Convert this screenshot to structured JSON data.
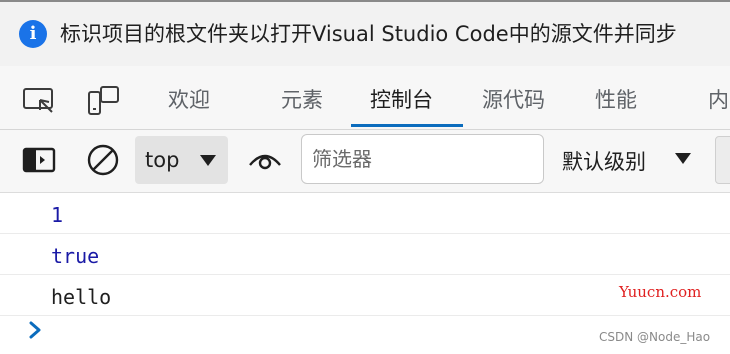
{
  "infobar": {
    "icon": "info-icon",
    "icon_glyph": "i",
    "message": "标识项目的根文件夹以打开Visual Studio Code中的源文件并同步"
  },
  "tabs": [
    {
      "label": "欢迎"
    },
    {
      "label": "元素"
    },
    {
      "label": "控制台",
      "active": true
    },
    {
      "label": "源代码"
    },
    {
      "label": "性能"
    },
    {
      "label": "内"
    }
  ],
  "toolbar": {
    "context_value": "top",
    "filter_placeholder": "筛选器",
    "levels_label": "默认级别"
  },
  "console": {
    "lines": [
      {
        "text": "1",
        "kind": "number"
      },
      {
        "text": "true",
        "kind": "boolean"
      },
      {
        "text": "hello",
        "kind": "string"
      }
    ]
  },
  "watermark": "Yuucn.com",
  "credit": "CSDN @Node_Hao",
  "colors": {
    "accent": "#0b6cbd",
    "info_icon": "#1a73e8",
    "number": "#1a1aa6",
    "watermark": "#e02020"
  }
}
